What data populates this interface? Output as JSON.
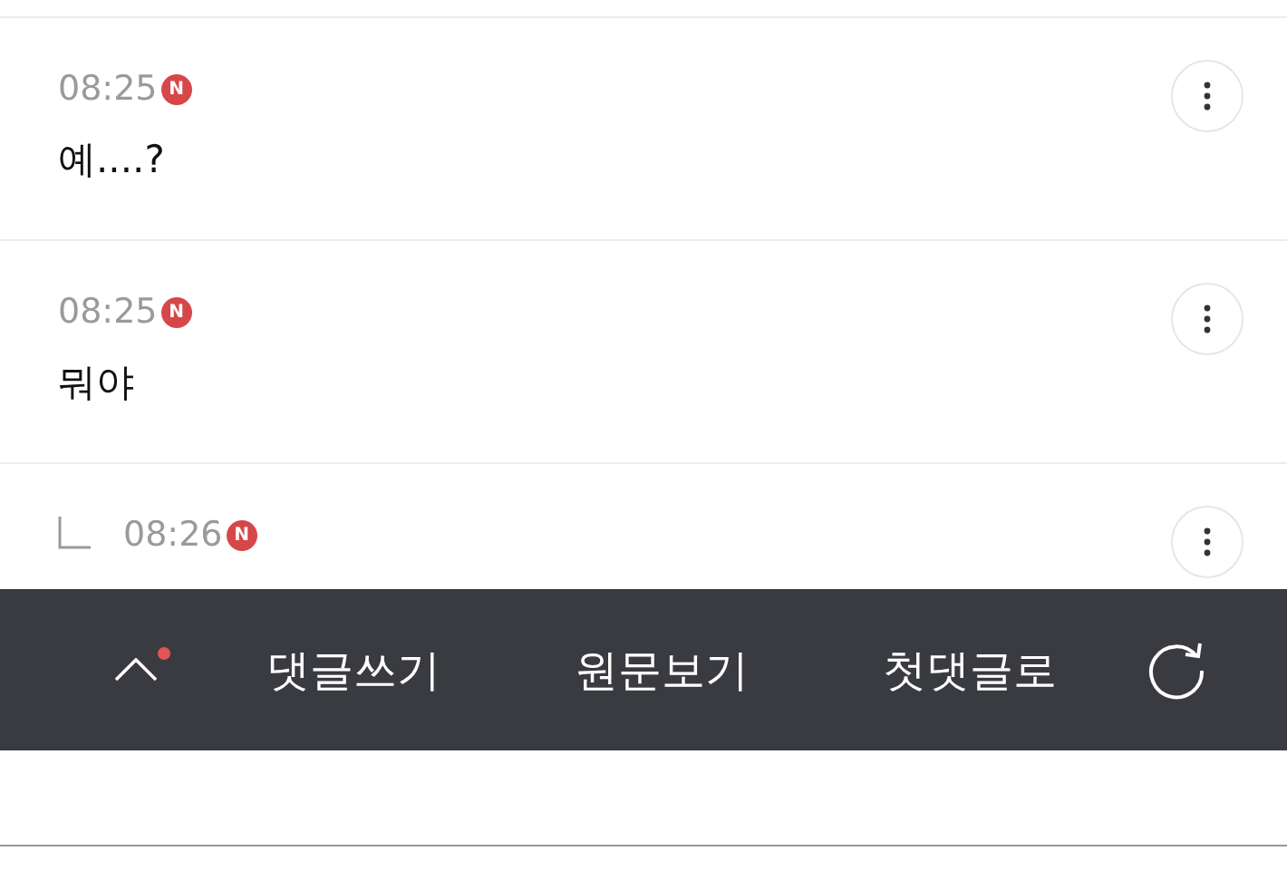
{
  "comments": [
    {
      "time": "08:25",
      "badge": "N",
      "text": "예....?",
      "reply": false
    },
    {
      "time": "08:25",
      "badge": "N",
      "text": "뭐야",
      "reply": false
    },
    {
      "time": "08:26",
      "badge": "N",
      "reply": true
    }
  ],
  "toolbar": {
    "new_dot": true,
    "buttons": [
      "댓글쓰기",
      "원문보기",
      "첫댓글로"
    ]
  }
}
